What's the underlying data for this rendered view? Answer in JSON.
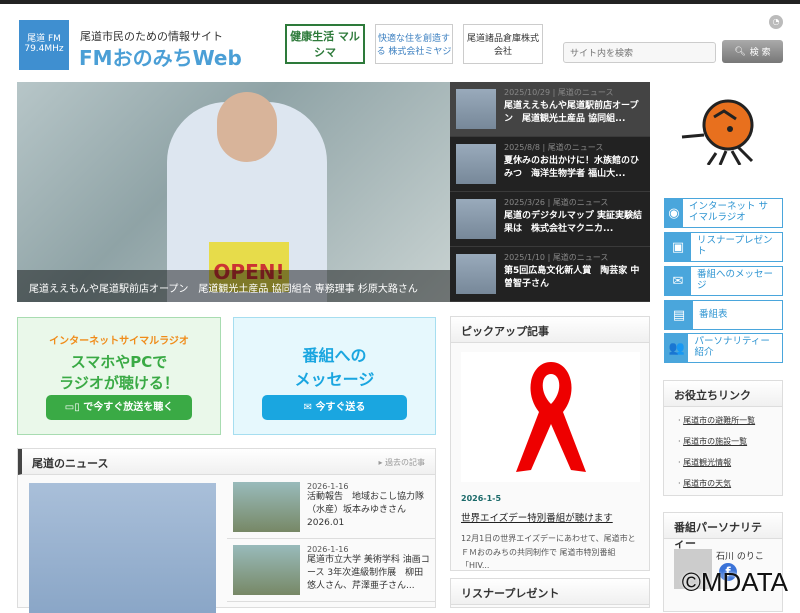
{
  "header": {
    "logo_text": "尾道 FM 79.4MHz",
    "tagline": "尾道市民のための情報サイト",
    "title": "FMおのみちWeb",
    "sponsors": [
      "健康生活 マルシマ",
      "快適な住を創造する 株式会社ミヤジ",
      "尾道諸品倉庫株式会社"
    ],
    "search_placeholder": "サイト内を検索",
    "search_button": "検 索"
  },
  "hero": {
    "caption": "尾道ええもんや尾道駅前店オープン　尾道観光土産品 協同組合 専務理事 杉原大路さん",
    "sign": "OPEN!"
  },
  "slider": [
    {
      "date": "2025/10/29",
      "category": "尾道のニュース",
      "title": "尾道ええもんや尾道駅前店オープン　尾道観光土産品 協同組..."
    },
    {
      "date": "2025/8/8",
      "category": "尾道のニュース",
      "title": "夏休みのお出かけに！水族館のひみつ　海洋生物学者 福山大..."
    },
    {
      "date": "2025/3/26",
      "category": "尾道のニュース",
      "title": "尾道のデジタルマップ 実証実験結果は　株式会社マクニカ..."
    },
    {
      "date": "2025/1/10",
      "category": "尾道のニュース",
      "title": "第5回広島文化新人賞　陶芸家 中曽智子さん"
    }
  ],
  "side_buttons": [
    {
      "icon": "antenna-icon",
      "glyph": "◉",
      "label": "インターネット サイマルラジオ"
    },
    {
      "icon": "gift-icon",
      "glyph": "▣",
      "label": "リスナープレゼント"
    },
    {
      "icon": "mail-icon",
      "glyph": "✉",
      "label": "番組へのメッセージ"
    },
    {
      "icon": "document-icon",
      "glyph": "▤",
      "label": "番組表"
    },
    {
      "icon": "people-icon",
      "glyph": "👥",
      "label": "パーソナリティー 紹介"
    }
  ],
  "banners": {
    "radio": {
      "sub": "インターネットサイマルラジオ",
      "main1": "スマホやPCで",
      "main2": "ラジオが聴ける！",
      "button": "で今すぐ放送を聴く"
    },
    "message": {
      "main1": "番組への",
      "main2": "メッセージ",
      "button": "今すぐ送る"
    }
  },
  "news": {
    "heading": "尾道のニュース",
    "more": "▸ 過去の記事",
    "items": [
      {
        "date": "2026-1-16",
        "title": "活動報告　地域おこし協力隊（水産）坂本みゆきさん 2026.01"
      },
      {
        "date": "2026-1-16",
        "title": "尾道市立大学 美術学科 油画コース 3年次進級制作展　柳田悠人さん、芹澤亜子さん..."
      }
    ]
  },
  "pickup": {
    "heading": "ピックアップ記事",
    "date": "2026-1-5",
    "title": "世界エイズデー特別番組が聴けます",
    "desc": "12月1日の世界エイズデーにあわせて、尾道市とＦＭおのみちの共同制作で 尾道市特別番組「HIV..."
  },
  "listener": {
    "heading": "リスナープレゼント"
  },
  "links": {
    "heading": "お役立ちリンク",
    "items": [
      "尾道市の避難所一覧",
      "尾道市の施設一覧",
      "尾道観光情報",
      "尾道市の天気"
    ]
  },
  "personality": {
    "heading": "番組パーソナリティー",
    "name": "石川 のりこ"
  },
  "watermark": "©MDATA",
  "colors": {
    "brand": "#4b9fd6",
    "green": "#3aaa45",
    "cyan": "#1aa6e0",
    "orange": "#e8701e"
  }
}
